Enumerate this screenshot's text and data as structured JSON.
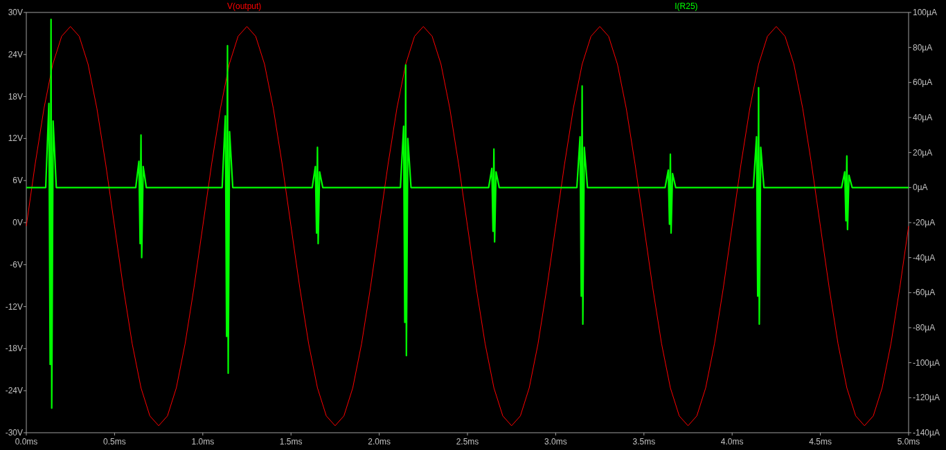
{
  "plot": {
    "voltage_chart": {
      "chart_data": {
        "type": "line",
        "xlim": [
          0,
          5
        ],
        "ylim": [
          -30,
          30
        ],
        "xticks": [
          {
            "value": 0,
            "label": "0.0ms"
          },
          {
            "value": 0.5,
            "label": "0.5ms"
          },
          {
            "value": 1,
            "label": "1.0ms"
          },
          {
            "value": 1.5,
            "label": "1.5ms"
          },
          {
            "value": 2,
            "label": "2.0ms"
          },
          {
            "value": 2.5,
            "label": "2.5ms"
          },
          {
            "value": 3,
            "label": "3.0ms"
          },
          {
            "value": 3.5,
            "label": "3.5ms"
          },
          {
            "value": 4,
            "label": "4.0ms"
          },
          {
            "value": 4.5,
            "label": "4.5ms"
          },
          {
            "value": 5,
            "label": "5.0ms"
          }
        ],
        "yticks": [
          {
            "value": 30,
            "label": "30V"
          },
          {
            "value": 24,
            "label": "24V"
          },
          {
            "value": 18,
            "label": "18V"
          },
          {
            "value": 12,
            "label": "12V"
          },
          {
            "value": 6,
            "label": "6V"
          },
          {
            "value": 0,
            "label": "0V"
          },
          {
            "value": -6,
            "label": "-6V"
          },
          {
            "value": -12,
            "label": "-12V"
          },
          {
            "value": -18,
            "label": "-18V"
          },
          {
            "value": -24,
            "label": "-24V"
          },
          {
            "value": -30,
            "label": "-30V"
          }
        ],
        "x": [
          0,
          0.05,
          0.1,
          0.15,
          0.2,
          0.25,
          0.3,
          0.35,
          0.4,
          0.45,
          0.5,
          0.55,
          0.6,
          0.65,
          0.7,
          0.75,
          0.8,
          0.85,
          0.9,
          0.95,
          1,
          1.05,
          1.1,
          1.15,
          1.2,
          1.25,
          1.3,
          1.35,
          1.4,
          1.45,
          1.5,
          1.55,
          1.6,
          1.65,
          1.7,
          1.75,
          1.8,
          1.85,
          1.9,
          1.95,
          2,
          2.05,
          2.1,
          2.15,
          2.2,
          2.25,
          2.3,
          2.35,
          2.4,
          2.45,
          2.5,
          2.55,
          2.6,
          2.65,
          2.7,
          2.75,
          2.8,
          2.85,
          2.9,
          2.95,
          3,
          3.05,
          3.1,
          3.15,
          3.2,
          3.25,
          3.3,
          3.35,
          3.4,
          3.45,
          3.5,
          3.55,
          3.6,
          3.65,
          3.7,
          3.75,
          3.8,
          3.85,
          3.9,
          3.95,
          4,
          4.05,
          4.1,
          4.15,
          4.2,
          4.25,
          4.3,
          4.35,
          4.4,
          4.45,
          4.5,
          4.55,
          4.6,
          4.65,
          4.7,
          4.75,
          4.8,
          4.85,
          4.9,
          4.95,
          5
        ],
        "series": [
          {
            "name": "V(output)",
            "color": "#ff0000",
            "values": [
              -0.5,
              8.3,
              16.3,
              22.6,
              26.6,
              28.0,
              26.6,
              22.6,
              16.3,
              8.3,
              -0.5,
              -9.3,
              -17.3,
              -23.6,
              -27.6,
              -29.0,
              -27.6,
              -23.6,
              -17.3,
              -9.3,
              -0.5,
              8.3,
              16.3,
              22.6,
              26.6,
              28.0,
              26.6,
              22.6,
              16.3,
              8.3,
              -0.5,
              -9.3,
              -17.3,
              -23.6,
              -27.6,
              -29.0,
              -27.6,
              -23.6,
              -17.3,
              -9.3,
              -0.5,
              8.3,
              16.3,
              22.6,
              26.6,
              28.0,
              26.6,
              22.6,
              16.3,
              8.3,
              -0.5,
              -9.3,
              -17.3,
              -23.6,
              -27.6,
              -29.0,
              -27.6,
              -23.6,
              -17.3,
              -9.3,
              -0.5,
              8.3,
              16.3,
              22.6,
              26.6,
              28.0,
              26.6,
              22.6,
              16.3,
              8.3,
              -0.5,
              -9.3,
              -17.3,
              -23.6,
              -27.6,
              -29.0,
              -27.6,
              -23.6,
              -17.3,
              -9.3,
              -0.5,
              8.3,
              16.3,
              22.6,
              26.6,
              28.0,
              26.6,
              22.6,
              16.3,
              8.3,
              -0.5,
              -9.3,
              -17.3,
              -23.6,
              -27.6,
              -29.0,
              -27.6,
              -23.6,
              -17.3,
              -9.3,
              -0.5
            ]
          }
        ]
      }
    },
    "current_chart": {
      "chart_data": {
        "type": "line",
        "xlim": [
          0,
          5
        ],
        "ylim": [
          -140,
          100
        ],
        "yticks": [
          {
            "value": 100,
            "label": "100µA"
          },
          {
            "value": 80,
            "label": "80µA"
          },
          {
            "value": 60,
            "label": "60µA"
          },
          {
            "value": 40,
            "label": "40µA"
          },
          {
            "value": 20,
            "label": "20µA"
          },
          {
            "value": 0,
            "label": "0µA"
          },
          {
            "value": -20,
            "label": "-20µA"
          },
          {
            "value": -40,
            "label": "-40µA"
          },
          {
            "value": -60,
            "label": "-60µA"
          },
          {
            "value": -80,
            "label": "-80µA"
          },
          {
            "value": -100,
            "label": "-100µA"
          },
          {
            "value": -120,
            "label": "-120µA"
          },
          {
            "value": -140,
            "label": "-140µA"
          }
        ],
        "x": [
          0,
          0.11,
          0.128,
          0.135,
          0.14,
          0.144,
          0.152,
          0.17,
          0.62,
          0.638,
          0.645,
          0.65,
          0.654,
          0.662,
          0.68,
          1.11,
          1.128,
          1.135,
          1.14,
          1.144,
          1.152,
          1.17,
          1.62,
          1.638,
          1.645,
          1.65,
          1.654,
          1.662,
          1.68,
          2.12,
          2.138,
          2.145,
          2.15,
          2.154,
          2.162,
          2.18,
          2.62,
          2.638,
          2.645,
          2.65,
          2.654,
          2.662,
          2.68,
          3.12,
          3.138,
          3.145,
          3.15,
          3.154,
          3.162,
          3.18,
          3.62,
          3.638,
          3.645,
          3.65,
          3.654,
          3.662,
          3.68,
          4.12,
          4.138,
          4.145,
          4.15,
          4.154,
          4.162,
          4.18,
          4.62,
          4.638,
          4.645,
          4.65,
          4.654,
          4.662,
          4.68,
          5
        ],
        "series": [
          {
            "name": "I(R25)",
            "color": "#00ff00",
            "values": [
              0,
              0,
              48,
              -101,
              96,
              -126,
              38,
              0,
              0,
              15,
              -32,
              30,
              -40,
              12,
              0,
              0,
              41,
              -85,
              81,
              -106,
              32,
              0,
              0,
              12,
              -26,
              23,
              -32,
              9,
              0,
              0,
              35,
              -77,
              70,
              -96,
              28,
              0,
              0,
              11,
              -25,
              22,
              -31,
              9,
              0,
              0,
              29,
              -62,
              58,
              -78,
              23,
              0,
              0,
              10,
              -21,
              19,
              -26,
              8,
              0,
              0,
              29,
              -62,
              57,
              -78,
              23,
              0,
              0,
              9,
              -19,
              18,
              -24,
              7,
              0,
              0
            ]
          }
        ]
      }
    }
  }
}
